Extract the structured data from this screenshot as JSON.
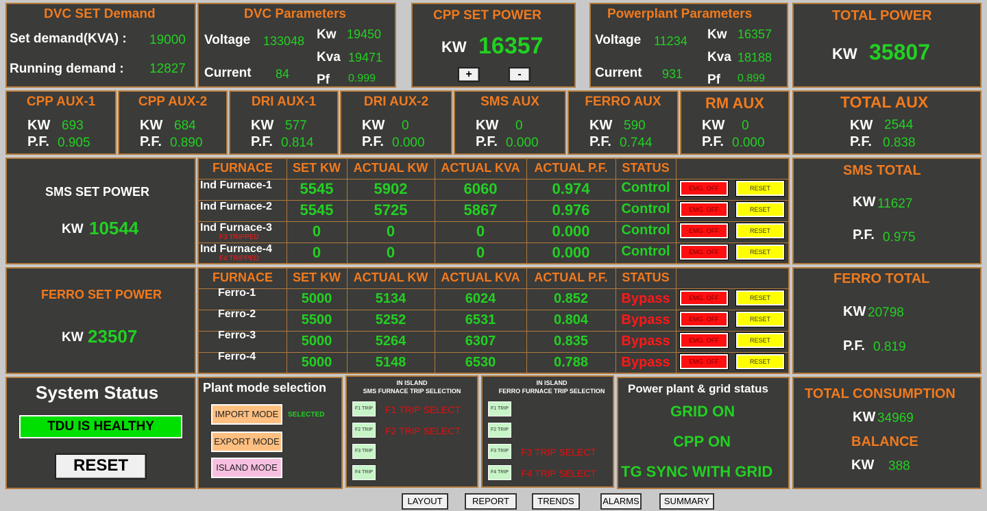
{
  "dvc_set": {
    "title": "DVC SET Demand",
    "set_label": "Set demand(KVA) :",
    "set_val": "19000",
    "run_label": "Running demand  :",
    "run_val": "12827"
  },
  "dvc_params": {
    "title": "DVC Parameters",
    "voltage_label": "Voltage",
    "voltage": "133048",
    "current_label": "Current",
    "current": "84",
    "kw_label": "Kw",
    "kw": "19450",
    "kva_label": "Kva",
    "kva": "19471",
    "pf_label": "Pf",
    "pf": "0.999"
  },
  "cpp_set": {
    "title": "CPP SET POWER",
    "kw_label": "KW",
    "kw": "16357",
    "plus": "+",
    "minus": "-"
  },
  "pp_params": {
    "title": "Powerplant Parameters",
    "voltage_label": "Voltage",
    "voltage": "11234",
    "current_label": "Current",
    "current": "931",
    "kw_label": "Kw",
    "kw": "16357",
    "kva_label": "Kva",
    "kva": "18188",
    "pf_label": "Pf",
    "pf": "0.899"
  },
  "total_power": {
    "title": "TOTAL POWER",
    "kw_label": "KW",
    "kw": "35807"
  },
  "aux": [
    {
      "title": "CPP AUX-1",
      "kw": "693",
      "pf": "0.905"
    },
    {
      "title": "CPP AUX-2",
      "kw": "684",
      "pf": "0.890"
    },
    {
      "title": "DRI AUX-1",
      "kw": "577",
      "pf": "0.814"
    },
    {
      "title": "DRI AUX-2",
      "kw": "0",
      "pf": "0.000"
    },
    {
      "title": "SMS AUX",
      "kw": "0",
      "pf": "0.000"
    },
    {
      "title": "FERRO AUX",
      "kw": "590",
      "pf": "0.744"
    },
    {
      "title": "RM AUX",
      "kw": "0",
      "pf": "0.000"
    }
  ],
  "aux_kw_label": "KW",
  "aux_pf_label": "P.F.",
  "total_aux": {
    "title": "TOTAL AUX",
    "kw": "2544",
    "pf": "0.838"
  },
  "sms_set": {
    "title": "SMS SET POWER",
    "kw_label": "KW",
    "kw": "10544"
  },
  "table_headers": [
    "FURNACE",
    "SET KW",
    "ACTUAL KW",
    "ACTUAL KVA",
    "ACTUAL P.F.",
    "STATUS"
  ],
  "sms_rows": [
    {
      "name": "Ind Furnace-1",
      "trip": "",
      "set": "5545",
      "kw": "5902",
      "kva": "6060",
      "pf": "0.974",
      "status": "Control"
    },
    {
      "name": "Ind Furnace-2",
      "trip": "",
      "set": "5545",
      "kw": "5725",
      "kva": "5867",
      "pf": "0.976",
      "status": "Control"
    },
    {
      "name": "Ind Furnace-3",
      "trip": "F3 TRIPPED",
      "set": "0",
      "kw": "0",
      "kva": "0",
      "pf": "0.000",
      "status": "Control"
    },
    {
      "name": "Ind Furnace-4",
      "trip": "F4 TRIPPED",
      "set": "0",
      "kw": "0",
      "kva": "0",
      "pf": "0.000",
      "status": "Control"
    }
  ],
  "emg_label": "EMG. OFF",
  "reset_small": "RESET",
  "sms_total": {
    "title": "SMS TOTAL",
    "kw_label": "KW",
    "kw": "11627",
    "pf_label": "P.F.",
    "pf": "0.975"
  },
  "ferro_set": {
    "title": "FERRO SET POWER",
    "kw_label": "KW",
    "kw": "23507"
  },
  "ferro_rows": [
    {
      "name": "Ferro-1",
      "set": "5000",
      "kw": "5134",
      "kva": "6024",
      "pf": "0.852",
      "status": "Bypass"
    },
    {
      "name": "Ferro-2",
      "set": "5500",
      "kw": "5252",
      "kva": "6531",
      "pf": "0.804",
      "status": "Bypass"
    },
    {
      "name": "Ferro-3",
      "set": "5000",
      "kw": "5264",
      "kva": "6307",
      "pf": "0.835",
      "status": "Bypass"
    },
    {
      "name": "Ferro-4",
      "set": "5000",
      "kw": "5148",
      "kva": "6530",
      "pf": "0.788",
      "status": "Bypass"
    }
  ],
  "ferro_total": {
    "title": "FERRO TOTAL",
    "kw_label": "KW",
    "kw": "20798",
    "pf_label": "P.F.",
    "pf": "0.819"
  },
  "system_status": {
    "title": "System Status",
    "status": "TDU IS HEALTHY",
    "reset": "RESET"
  },
  "plant_mode": {
    "title": "Plant mode selection",
    "import": "IMPORT MODE",
    "export": "EXPORT MODE",
    "island": "ISLAND MODE",
    "selected": "SELECTED"
  },
  "sms_trip": {
    "title1": "IN ISLAND",
    "title2": "SMS FURNACE TRIP SELECTION",
    "buttons": [
      "F1 TRIP",
      "F2 TRIP",
      "F3 TRIP",
      "F4 TRIP"
    ],
    "f1": "F1 TRIP SELECT",
    "f2": "F2 TRIP SELECT"
  },
  "ferro_trip": {
    "title1": "IN ISLAND",
    "title2": "FERRO FURNACE TRIP SELECTION",
    "buttons": [
      "F1 TRIP",
      "F2 TRIP",
      "F3 TRIP",
      "F4 TRIP"
    ],
    "f3": "F3 TRIP SELECT",
    "f4": "F4 TRIP SELECT"
  },
  "grid_status": {
    "title": "Power plant & grid status",
    "l1": "GRID ON",
    "l2": "CPP ON",
    "l3": "TG SYNC WITH GRID"
  },
  "total_consumption": {
    "title": "TOTAL CONSUMPTION",
    "kw_label": "KW",
    "kw": "34969",
    "balance_title": "BALANCE",
    "balance_label": "KW",
    "balance": "388"
  },
  "nav": [
    "LAYOUT",
    "REPORT",
    "TRENDS",
    "ALARMS",
    "SUMMARY"
  ]
}
